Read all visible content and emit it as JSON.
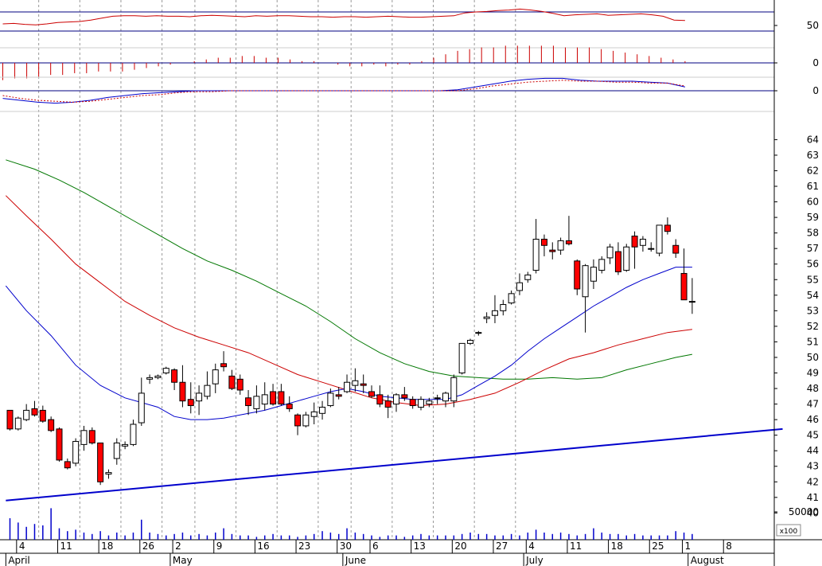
{
  "chart_data": {
    "type": "candlestick",
    "colors": {
      "up_fill": "#ffffff",
      "down_fill": "#ff0000",
      "outline": "#000000",
      "ma_short": "#0000cc",
      "ma_mid": "#cc0000",
      "ma_long": "#007700",
      "trendline": "#0000cc",
      "panel_line": "#000080",
      "rsi": "#cc0000",
      "macd": "#0000cc",
      "macd_signal": "#cc0000",
      "hist": "#cc0000",
      "volume": "#0000cc",
      "grid": "#999999"
    },
    "price_axis": {
      "ylim": [
        39.2,
        65.3
      ],
      "ticks": [
        40,
        41,
        42,
        43,
        44,
        45,
        46,
        47,
        48,
        49,
        50,
        51,
        52,
        53,
        54,
        55,
        56,
        57,
        58,
        59,
        60,
        61,
        62,
        63,
        64
      ]
    },
    "rsi_axis": {
      "ylim": [
        0,
        100
      ],
      "ticks": [
        50
      ],
      "ref_lines": [
        70,
        30
      ]
    },
    "hist_axis": {
      "ticks": [
        0
      ]
    },
    "macd_axis": {
      "ticks": [
        0
      ]
    },
    "volume_axis": {
      "ticks": [
        "50000"
      ],
      "unit_label": "x100"
    },
    "x_axis": {
      "count": 63,
      "grid_index": [
        3,
        8,
        13,
        18,
        22,
        27,
        32,
        37,
        41,
        46,
        51,
        56,
        61
      ],
      "day_ticks": [
        {
          "i": 1,
          "label": "4"
        },
        {
          "i": 6,
          "label": "11"
        },
        {
          "i": 11,
          "label": "18"
        },
        {
          "i": 16,
          "label": "26"
        },
        {
          "i": 20,
          "label": "2"
        },
        {
          "i": 25,
          "label": "9"
        },
        {
          "i": 30,
          "label": "16"
        },
        {
          "i": 35,
          "label": "23"
        },
        {
          "i": 40,
          "label": "30"
        },
        {
          "i": 44,
          "label": "6"
        },
        {
          "i": 49,
          "label": "13"
        },
        {
          "i": 54,
          "label": "20"
        },
        {
          "i": 59,
          "label": "27"
        },
        {
          "i": 63,
          "label": "4"
        },
        {
          "i": 68,
          "label": "11"
        },
        {
          "i": 73,
          "label": "18"
        },
        {
          "i": 78,
          "label": "25"
        },
        {
          "i": 82,
          "label": "1"
        },
        {
          "i": 87,
          "label": "8"
        }
      ],
      "month_labels": [
        {
          "i": -0.5,
          "label": "April"
        },
        {
          "i": 19.5,
          "label": "May"
        },
        {
          "i": 40.5,
          "label": "June"
        },
        {
          "i": 62.5,
          "label": "July"
        },
        {
          "i": 82.5,
          "label": "August"
        }
      ]
    },
    "candles": [
      [
        46.6,
        46.6,
        45.3,
        45.4
      ],
      [
        45.4,
        46.2,
        45.3,
        46.1
      ],
      [
        46.0,
        47.0,
        45.9,
        46.6
      ],
      [
        46.7,
        47.2,
        46.2,
        46.3
      ],
      [
        46.6,
        46.9,
        45.8,
        45.9
      ],
      [
        46.0,
        46.2,
        45.2,
        45.3
      ],
      [
        45.4,
        45.5,
        43.3,
        43.4
      ],
      [
        43.3,
        43.5,
        42.8,
        42.9
      ],
      [
        43.2,
        44.8,
        43.0,
        44.6
      ],
      [
        44.4,
        45.6,
        44.0,
        45.3
      ],
      [
        45.3,
        45.5,
        44.4,
        44.5
      ],
      [
        44.5,
        44.5,
        41.8,
        42.0
      ],
      [
        42.5,
        42.8,
        42.2,
        42.6
      ],
      [
        43.5,
        44.8,
        43.1,
        44.5
      ],
      [
        44.3,
        44.6,
        44.1,
        44.4
      ],
      [
        44.4,
        46.0,
        44.3,
        45.7
      ],
      [
        45.8,
        48.7,
        45.6,
        47.7
      ],
      [
        48.6,
        48.9,
        48.3,
        48.7
      ],
      [
        48.7,
        48.9,
        48.6,
        48.8
      ],
      [
        49.0,
        49.4,
        48.9,
        49.3
      ],
      [
        49.2,
        49.3,
        47.9,
        48.4
      ],
      [
        48.4,
        49.5,
        46.8,
        47.2
      ],
      [
        47.3,
        48.4,
        46.4,
        46.9
      ],
      [
        47.2,
        48.2,
        46.3,
        47.7
      ],
      [
        47.5,
        49.1,
        47.3,
        48.2
      ],
      [
        48.3,
        49.6,
        47.7,
        49.2
      ],
      [
        49.6,
        50.4,
        49.1,
        49.4
      ],
      [
        48.8,
        49.2,
        47.9,
        48.0
      ],
      [
        48.6,
        48.9,
        47.6,
        47.9
      ],
      [
        47.4,
        47.9,
        46.3,
        46.9
      ],
      [
        46.7,
        48.2,
        46.4,
        47.5
      ],
      [
        47.0,
        48.4,
        46.6,
        47.6
      ],
      [
        47.8,
        48.3,
        46.9,
        47.0
      ],
      [
        47.8,
        48.3,
        46.9,
        47.0
      ],
      [
        47.0,
        47.5,
        46.5,
        46.7
      ],
      [
        46.3,
        46.4,
        45.0,
        45.6
      ],
      [
        45.6,
        46.5,
        45.5,
        46.3
      ],
      [
        46.2,
        47.1,
        45.7,
        46.5
      ],
      [
        46.4,
        47.2,
        46.0,
        46.8
      ],
      [
        46.9,
        48.0,
        46.8,
        47.7
      ],
      [
        47.6,
        48.1,
        47.3,
        47.5
      ],
      [
        47.8,
        48.9,
        47.7,
        48.4
      ],
      [
        48.2,
        49.3,
        47.8,
        48.5
      ],
      [
        48.3,
        48.9,
        47.7,
        48.2
      ],
      [
        47.8,
        48.2,
        47.4,
        47.5
      ],
      [
        47.6,
        48.2,
        46.8,
        47.0
      ],
      [
        47.2,
        47.6,
        46.1,
        46.8
      ],
      [
        47.0,
        47.7,
        46.5,
        47.6
      ],
      [
        47.6,
        48.1,
        47.2,
        47.4
      ],
      [
        47.3,
        47.5,
        46.7,
        46.9
      ],
      [
        46.8,
        47.5,
        46.6,
        47.3
      ],
      [
        47.0,
        47.4,
        46.8,
        47.2
      ],
      [
        47.4,
        47.6,
        47.0,
        47.4
      ],
      [
        47.2,
        47.8,
        46.8,
        47.7
      ],
      [
        47.2,
        48.9,
        46.8,
        48.7
      ],
      [
        49.0,
        50.9,
        48.9,
        50.9
      ],
      [
        50.9,
        51.2,
        50.8,
        51.1
      ],
      [
        51.6,
        51.7,
        51.4,
        51.6
      ],
      [
        52.5,
        52.9,
        52.2,
        52.6
      ],
      [
        52.7,
        54.0,
        52.2,
        53.0
      ],
      [
        53.0,
        53.7,
        52.7,
        53.4
      ],
      [
        53.5,
        54.3,
        53.4,
        54.1
      ],
      [
        54.3,
        55.4,
        54.0,
        54.8
      ],
      [
        55.0,
        55.5,
        54.8,
        55.3
      ],
      [
        55.6,
        58.9,
        55.4,
        57.6
      ],
      [
        57.6,
        57.9,
        56.5,
        57.2
      ],
      [
        56.9,
        57.4,
        56.3,
        56.8
      ],
      [
        56.9,
        57.7,
        56.6,
        57.5
      ],
      [
        57.5,
        59.1,
        57.2,
        57.3
      ],
      [
        56.2,
        56.3,
        54.0,
        54.4
      ],
      [
        53.9,
        56.0,
        51.6,
        55.9
      ],
      [
        54.9,
        56.3,
        54.4,
        55.8
      ],
      [
        55.6,
        56.5,
        55.4,
        56.3
      ],
      [
        56.4,
        57.3,
        56.0,
        57.1
      ],
      [
        56.8,
        57.4,
        55.3,
        55.5
      ],
      [
        55.6,
        57.3,
        55.5,
        57.1
      ],
      [
        57.8,
        58.1,
        55.7,
        57.1
      ],
      [
        57.2,
        57.8,
        56.8,
        57.6
      ],
      [
        57.0,
        57.4,
        56.8,
        57.0
      ],
      [
        56.7,
        58.3,
        56.5,
        58.5
      ],
      [
        58.5,
        59.0,
        57.9,
        58.1
      ],
      [
        57.2,
        57.6,
        56.4,
        56.7
      ],
      [
        55.4,
        57.0,
        53.9,
        53.7
      ],
      [
        53.6,
        55.1,
        52.8,
        53.6
      ]
    ],
    "ma_short": [
      [
        -0.5,
        54.6
      ],
      [
        2,
        53.0
      ],
      [
        5,
        51.4
      ],
      [
        8,
        49.5
      ],
      [
        11,
        48.2
      ],
      [
        14,
        47.4
      ],
      [
        16,
        47.1
      ],
      [
        18,
        46.8
      ],
      [
        20,
        46.2
      ],
      [
        22,
        46.0
      ],
      [
        24,
        46.0
      ],
      [
        26,
        46.1
      ],
      [
        28,
        46.3
      ],
      [
        31,
        46.6
      ],
      [
        33,
        46.9
      ],
      [
        35,
        47.2
      ],
      [
        37,
        47.5
      ],
      [
        39,
        47.8
      ],
      [
        41,
        48.0
      ],
      [
        43,
        47.8
      ],
      [
        45,
        47.5
      ],
      [
        47,
        47.4
      ],
      [
        49,
        47.3
      ],
      [
        51,
        47.3
      ],
      [
        53,
        47.3
      ],
      [
        55,
        47.6
      ],
      [
        57,
        48.2
      ],
      [
        59,
        48.8
      ],
      [
        61,
        49.5
      ],
      [
        63,
        50.4
      ],
      [
        65,
        51.2
      ],
      [
        67,
        51.9
      ],
      [
        69,
        52.6
      ],
      [
        71,
        53.3
      ],
      [
        73,
        53.9
      ],
      [
        75,
        54.5
      ],
      [
        77,
        55.0
      ],
      [
        79,
        55.4
      ],
      [
        81,
        55.8
      ],
      [
        83,
        55.8
      ]
    ],
    "ma_mid": [
      [
        -0.5,
        60.4
      ],
      [
        2,
        59.1
      ],
      [
        5,
        57.6
      ],
      [
        8,
        56.0
      ],
      [
        11,
        54.8
      ],
      [
        14,
        53.6
      ],
      [
        17,
        52.7
      ],
      [
        20,
        51.9
      ],
      [
        23,
        51.3
      ],
      [
        26,
        50.8
      ],
      [
        29,
        50.3
      ],
      [
        32,
        49.6
      ],
      [
        35,
        48.9
      ],
      [
        38,
        48.4
      ],
      [
        41,
        47.9
      ],
      [
        44,
        47.4
      ],
      [
        47,
        47.1
      ],
      [
        50,
        46.9
      ],
      [
        53,
        47.0
      ],
      [
        56,
        47.3
      ],
      [
        59,
        47.7
      ],
      [
        62,
        48.4
      ],
      [
        65,
        49.2
      ],
      [
        68,
        49.9
      ],
      [
        71,
        50.3
      ],
      [
        74,
        50.8
      ],
      [
        77,
        51.2
      ],
      [
        80,
        51.6
      ],
      [
        83,
        51.8
      ]
    ],
    "ma_long": [
      [
        -0.5,
        62.7
      ],
      [
        3,
        62.1
      ],
      [
        6,
        61.4
      ],
      [
        9,
        60.6
      ],
      [
        12,
        59.7
      ],
      [
        15,
        58.8
      ],
      [
        18,
        57.9
      ],
      [
        21,
        57.0
      ],
      [
        24,
        56.2
      ],
      [
        27,
        55.6
      ],
      [
        30,
        54.9
      ],
      [
        33,
        54.1
      ],
      [
        36,
        53.3
      ],
      [
        39,
        52.3
      ],
      [
        42,
        51.2
      ],
      [
        45,
        50.3
      ],
      [
        48,
        49.6
      ],
      [
        51,
        49.1
      ],
      [
        54,
        48.8
      ],
      [
        57,
        48.7
      ],
      [
        60,
        48.6
      ],
      [
        63,
        48.6
      ],
      [
        66,
        48.7
      ],
      [
        69,
        48.6
      ],
      [
        72,
        48.7
      ],
      [
        75,
        49.2
      ],
      [
        78,
        49.6
      ],
      [
        81,
        50.0
      ],
      [
        83,
        50.2
      ]
    ],
    "trendline": {
      "from": [
        -0.5,
        40.8
      ],
      "to": [
        94,
        45.4
      ]
    },
    "rsi": [
      45,
      46,
      44,
      43,
      45,
      48,
      49,
      50,
      53,
      57,
      61,
      62,
      62,
      61,
      62,
      61,
      61,
      60,
      62,
      63,
      62,
      61,
      60,
      62,
      61,
      62,
      62,
      61,
      60,
      60,
      59,
      60,
      60,
      59,
      60,
      61,
      60,
      59,
      59,
      60,
      61,
      62,
      68,
      70,
      71,
      73,
      74,
      76,
      74,
      71,
      67,
      62,
      64,
      65,
      66,
      63,
      64,
      65,
      66,
      64,
      61,
      53,
      52
    ],
    "rsi_x_scale": 83,
    "hist": [
      -1.0,
      -0.9,
      -0.9,
      -0.8,
      -0.7,
      -0.7,
      -0.6,
      -0.6,
      -0.5,
      -0.5,
      -0.5,
      -0.4,
      -0.3,
      -0.2,
      -0.1,
      0.0,
      0.1,
      0.2,
      0.3,
      0.3,
      0.4,
      0.4,
      0.3,
      0.3,
      0.2,
      0.1,
      0.1,
      0.0,
      -0.1,
      -0.2,
      -0.2,
      -0.1,
      -0.2,
      -0.1,
      -0.1,
      0.1,
      0.3,
      0.5,
      0.7,
      0.8,
      0.9,
      0.9,
      1.0,
      1.0,
      1.0,
      1.0,
      1.0,
      0.9,
      0.9,
      0.9,
      0.8,
      0.7,
      0.6,
      0.5,
      0.4,
      0.3,
      0.2,
      0.1
    ],
    "hist_x_scale": 83,
    "macd_line": [
      -0.8,
      -1.0,
      -1.2,
      -1.3,
      -1.2,
      -1.0,
      -0.7,
      -0.5,
      -0.3,
      -0.2,
      -0.1,
      0.0,
      0.0,
      0.0,
      0.0,
      0.0,
      0.0,
      0.0,
      0.0,
      0.0,
      0.0,
      0.0,
      0.0,
      0.0,
      0.0,
      0.0,
      0.1,
      0.4,
      0.7,
      1.0,
      1.2,
      1.3,
      1.3,
      1.1,
      1.0,
      1.0,
      1.0,
      0.9,
      0.8,
      0.4
    ],
    "macd_signal": [
      -0.5,
      -0.8,
      -1.0,
      -1.1,
      -1.2,
      -1.1,
      -0.9,
      -0.7,
      -0.5,
      -0.4,
      -0.2,
      -0.1,
      -0.1,
      0.0,
      0.0,
      0.0,
      0.0,
      0.0,
      0.0,
      0.0,
      0.0,
      0.0,
      0.0,
      0.0,
      0.0,
      0.0,
      0.0,
      0.2,
      0.5,
      0.7,
      0.9,
      1.0,
      1.1,
      1.0,
      1.0,
      0.9,
      0.9,
      0.8,
      0.8,
      0.5
    ],
    "macd_x_scale": 83,
    "volume": [
      1.5,
      1.2,
      0.9,
      1.1,
      1.0,
      2.2,
      0.8,
      0.6,
      0.7,
      0.5,
      0.4,
      0.6,
      0.3,
      0.5,
      0.3,
      0.5,
      1.4,
      0.5,
      0.4,
      0.3,
      0.4,
      0.5,
      0.3,
      0.4,
      0.3,
      0.5,
      0.8,
      0.4,
      0.3,
      0.3,
      0.2,
      0.3,
      0.4,
      0.3,
      0.3,
      0.2,
      0.3,
      0.4,
      0.6,
      0.5,
      0.4,
      0.8,
      0.5,
      0.4,
      0.3,
      0.2,
      0.3,
      0.3,
      0.2,
      0.3,
      0.4,
      0.3,
      0.3,
      0.3,
      0.3,
      0.4,
      0.5,
      0.4,
      0.4,
      0.3,
      0.3,
      0.4,
      0.3,
      0.5,
      0.7,
      0.5,
      0.4,
      0.5,
      0.4,
      0.3,
      0.4,
      0.8,
      0.5,
      0.4,
      0.4,
      0.3,
      0.4,
      0.3,
      0.3,
      0.3,
      0.3,
      0.6,
      0.5,
      0.4
    ]
  }
}
